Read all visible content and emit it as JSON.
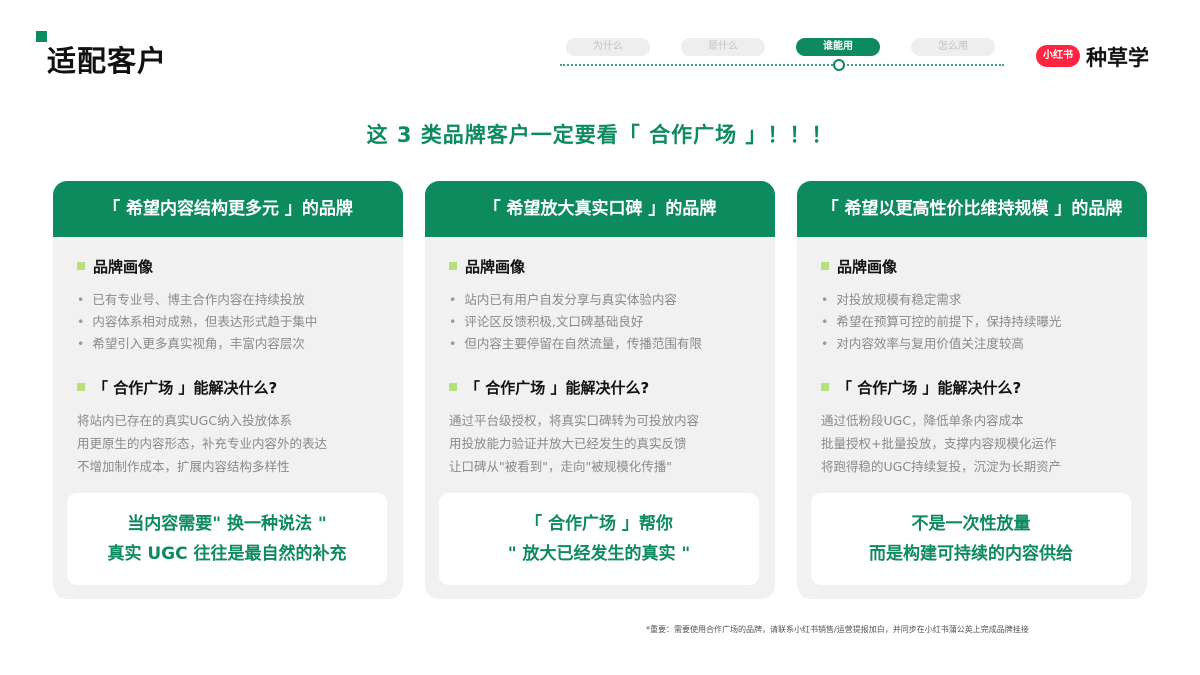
{
  "page": {
    "title": "适配客户",
    "accent_color": "#0e8a5f"
  },
  "nav": {
    "tabs": [
      "为什么",
      "是什么",
      "谁能用",
      "怎么用"
    ],
    "active_index": 2
  },
  "brand": {
    "badge": "小红书",
    "name": "种草学",
    "badge_color": "#ff2442"
  },
  "headline": "这 3 类品牌客户一定要看「 合作广场 」！！！",
  "cards": [
    {
      "header": "「 希望内容结构更多元 」的品牌",
      "section1_title": "品牌画像",
      "bullets": [
        "已有专业号、博主合作内容在持续投放",
        "内容体系相对成熟，但表达形式趋于集中",
        "希望引入更多真实视角，丰富内容层次"
      ],
      "section2_title": "「 合作广场 」能解决什么?",
      "paragraph": [
        "将站内已存在的真实UGC纳入投放体系",
        "用更原生的内容形态，补充专业内容外的表达",
        "不增加制作成本，扩展内容结构多样性"
      ],
      "callout": [
        "当内容需要\" 换一种说法 \"",
        "真实 UGC 往往是最自然的补充"
      ]
    },
    {
      "header": "「 希望放大真实口碑 」的品牌",
      "section1_title": "品牌画像",
      "bullets": [
        "站内已有用户自发分享与真实体验内容",
        "评论区反馈积极,文口碑基础良好",
        "但内容主要停留在自然流量，传播范围有限"
      ],
      "section2_title": "「 合作广场 」能解决什么?",
      "paragraph": [
        "通过平台级授权，将真实口碑转为可投放内容",
        "用投放能力验证并放大已经发生的真实反馈",
        "让口碑从\"被看到\"，走向\"被规模化传播\""
      ],
      "callout": [
        "「 合作广场 」帮你",
        "\" 放大已经发生的真实 \""
      ]
    },
    {
      "header": "「 希望以更高性价比维持规模 」的品牌",
      "section1_title": "品牌画像",
      "bullets": [
        "对投放规模有稳定需求",
        "希望在预算可控的前提下，保持持续曝光",
        "对内容效率与复用价值关注度较高"
      ],
      "section2_title": "「 合作广场 」能解决什么?",
      "paragraph": [
        "通过低粉段UGC，降低单条内容成本",
        "批量授权+批量投放，支撑内容规模化运作",
        "将跑得稳的UGC持续复投，沉淀为长期资产"
      ],
      "callout": [
        "不是一次性放量",
        "而是构建可持续的内容供给"
      ]
    }
  ],
  "footnote": "*重要：需要使用合作广场的品牌，请联系小红书销售/运营提报加白，并同步在小红书蒲公英上完成品牌挂接"
}
